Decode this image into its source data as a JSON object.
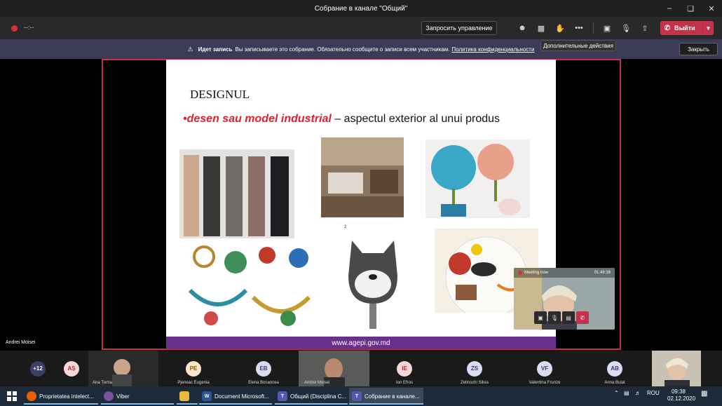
{
  "window": {
    "title": "Собрание в канале \"Общий\""
  },
  "toolbar": {
    "timer": "--:--",
    "request_control_label": "Запросить управление",
    "leave_label": "Выйти",
    "more_actions_tooltip": "Дополнительные действия"
  },
  "banner": {
    "title": "Идет запись",
    "message": "Вы записываете это собрание. Обязательно сообщите о записи всем участникам.",
    "link": "Политика конфиденциальности",
    "close_label": "Закрыть"
  },
  "slide": {
    "title": "DESIGNUL",
    "bullet_highlight": "•desen sau model industrial",
    "bullet_rest": " – aspectul exterior al unui produs",
    "slide_number": "2",
    "footer": "www.agepi.gov.md"
  },
  "presenter": {
    "name": "Andrei Moisei"
  },
  "pip": {
    "status": "Meeting now",
    "time": "01:48:16"
  },
  "participants": [
    {
      "initials": "+12",
      "name": "",
      "color": "#3d3e66"
    },
    {
      "initials": "AȘ",
      "name": "",
      "color": "#f6d6d6"
    },
    {
      "initials": "",
      "name": "Ana Țerna",
      "color": ""
    },
    {
      "initials": "PE",
      "name": "Pjeneac Eugenia",
      "color": "#f8e7c8"
    },
    {
      "initials": "EB",
      "name": "Elena Bocancea",
      "color": "#d9dcf2"
    },
    {
      "initials": "",
      "name": "Andrei Moisei",
      "color": ""
    },
    {
      "initials": "IE",
      "name": "Ion Efros",
      "color": "#f6d6d6"
    },
    {
      "initials": "ZS",
      "name": "Zelinschi Silvia",
      "color": "#d9dcf2"
    },
    {
      "initials": "VF",
      "name": "Valentina Frunze",
      "color": "#d9dcf2"
    },
    {
      "initials": "AB",
      "name": "Anna Bulat",
      "color": "#d9dcf2"
    }
  ],
  "taskbar": {
    "tasks": [
      {
        "label": "Proprietatea intelect...",
        "icon": "firefox-icon",
        "color": "#e66000"
      },
      {
        "label": "Viber",
        "icon": "viber-icon",
        "color": "#7b519d"
      },
      {
        "label": "",
        "icon": "folder-icon",
        "color": "#e8b93a"
      },
      {
        "label": "Document Microsoft...",
        "icon": "word-icon",
        "color": "#2b579a"
      },
      {
        "label": "Общий (Disciplina C...",
        "icon": "teams-icon",
        "color": "#5558af"
      },
      {
        "label": "Собрание в канале...",
        "icon": "teams-icon",
        "color": "#5558af"
      }
    ],
    "language": "ROU",
    "time": "09:38",
    "date": "02.12.2020"
  }
}
